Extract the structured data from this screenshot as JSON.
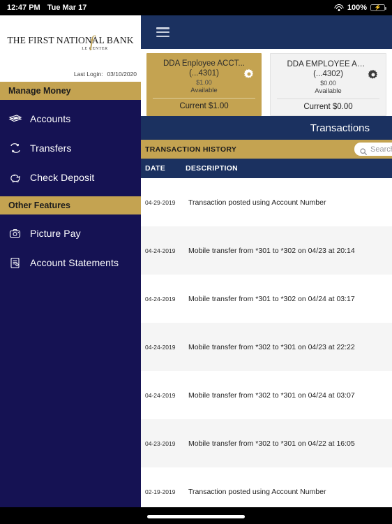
{
  "status_bar": {
    "time": "12:47 PM",
    "date": "Tue Mar 17",
    "battery_percent": "100%",
    "wifi_icon": "wifi-icon",
    "battery_icon": "battery-charging-icon"
  },
  "sidebar": {
    "logo": {
      "line1": "THE FIRST NATIONAL BANK",
      "script": "f",
      "subtitle": "LE CENTER"
    },
    "last_login_label": "Last Login:",
    "last_login_date": "03/10/2020",
    "sections": [
      {
        "header": "Manage Money",
        "items": [
          {
            "label": "Accounts",
            "icon": "money-icon"
          },
          {
            "label": "Transfers",
            "icon": "transfer-arrows-icon"
          },
          {
            "label": "Check Deposit",
            "icon": "piggy-bank-icon"
          }
        ]
      },
      {
        "header": "Other Features",
        "items": [
          {
            "label": "Picture Pay",
            "icon": "camera-icon"
          },
          {
            "label": "Account Statements",
            "icon": "document-icon"
          }
        ]
      }
    ]
  },
  "main": {
    "menu_icon": "hamburger-menu-icon",
    "accounts": [
      {
        "name": "DDA Enployee ACCT...",
        "number": "(...4301)",
        "available_amount": "$1.00",
        "available_label": "Available",
        "current": "Current $1.00",
        "gear_icon": "gear-icon",
        "selected": true
      },
      {
        "name": "DDA EMPLOYEE AC...",
        "number": "(...4302)",
        "available_amount": "$0.00",
        "available_label": "Available",
        "current": "Current $0.00",
        "gear_icon": "gear-icon",
        "selected": false
      }
    ],
    "transactions_title": "Transactions",
    "history_label": "TRANSACTION HISTORY",
    "search": {
      "placeholder": "Search",
      "icon": "search-icon",
      "value": ""
    },
    "columns": {
      "date": "DATE",
      "description": "DESCRIPTION"
    },
    "rows": [
      {
        "date": "04-29-2019",
        "description": "Transaction posted using Account Number"
      },
      {
        "date": "04-24-2019",
        "description": "Mobile transfer from *301 to *302 on 04/23 at 20:14"
      },
      {
        "date": "04-24-2019",
        "description": "Mobile transfer from *301 to *302 on 04/24 at 03:17"
      },
      {
        "date": "04-24-2019",
        "description": "Mobile transfer from *302 to *301 on 04/23 at 22:22"
      },
      {
        "date": "04-24-2019",
        "description": "Mobile transfer from *302 to *301 on 04/24 at 03:07"
      },
      {
        "date": "04-23-2019",
        "description": "Mobile transfer from *302 to *301 on 04/22 at 16:05"
      },
      {
        "date": "02-19-2019",
        "description": "Transaction posted using Account Number"
      }
    ]
  },
  "colors": {
    "navy_sidebar": "#151253",
    "navy_header": "#1b3160",
    "gold": "#c4a351",
    "row_alt": "#f5f5f5",
    "battery_green": "#34c759"
  }
}
